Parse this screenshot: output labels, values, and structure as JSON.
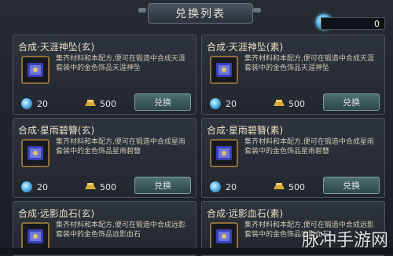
{
  "header": {
    "title": "兑换列表"
  },
  "currency": {
    "value": "0",
    "icon": "blue-gem-icon"
  },
  "items": [
    {
      "title": "合成·天涯神坠(玄)",
      "description": "集齐材料和本配方,便可在锻造中合成天涯套装中的金色饰品天涯神坠",
      "gem_cost": "20",
      "gold_cost": "500",
      "button_label": "兑换"
    },
    {
      "title": "合成·天涯神坠(素)",
      "description": "集齐材料和本配方,便可在锻造中合成天涯套装中的金色饰品天涯神坠",
      "gem_cost": "20",
      "gold_cost": "500",
      "button_label": "兑换"
    },
    {
      "title": "合成·星雨碧簪(玄)",
      "description": "集齐材料和本配方,便可在锻造中合成星雨套装中的金色饰品星雨碧簪",
      "gem_cost": "20",
      "gold_cost": "500",
      "button_label": "兑换"
    },
    {
      "title": "合成·星雨碧簪(素)",
      "description": "集齐材料和本配方,便可在锻造中合成星雨套装中的金色饰品星雨碧簪",
      "gem_cost": "20",
      "gold_cost": "500",
      "button_label": "兑换"
    },
    {
      "title": "合成·远影血石(玄)",
      "description": "集齐材料和本配方,便可在锻造中合成远影套装中的金色饰品远影血石",
      "gem_cost": "",
      "gold_cost": "",
      "button_label": ""
    },
    {
      "title": "合成·远影血石(素)",
      "description": "集齐材料和本配方,便可在锻造中合成远影套装中的金色饰品远影血石",
      "gem_cost": "",
      "gold_cost": "",
      "button_label": ""
    }
  ],
  "watermark": "脉冲手游网",
  "colors": {
    "gold_frame": "#8f6e3a",
    "button": "#4f6f70",
    "gem": "#59b6e8"
  }
}
